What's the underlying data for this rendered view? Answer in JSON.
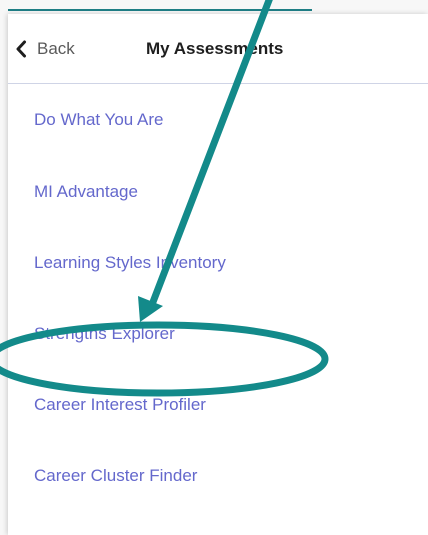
{
  "header": {
    "back_label": "Back",
    "title": "My Assessments"
  },
  "menu": {
    "items": [
      {
        "label": "Do What You Are"
      },
      {
        "label": "MI Advantage"
      },
      {
        "label": "Learning Styles Inventory"
      },
      {
        "label": "Strengths Explorer",
        "highlighted": true
      },
      {
        "label": "Career Interest Profiler"
      },
      {
        "label": "Career Cluster Finder"
      }
    ]
  },
  "colors": {
    "accent": "#1f7f86",
    "link": "#6468cc",
    "annotation": "#138a8a",
    "divider": "#cfd4e6"
  },
  "icons": {
    "back": "chevron-left-icon"
  }
}
